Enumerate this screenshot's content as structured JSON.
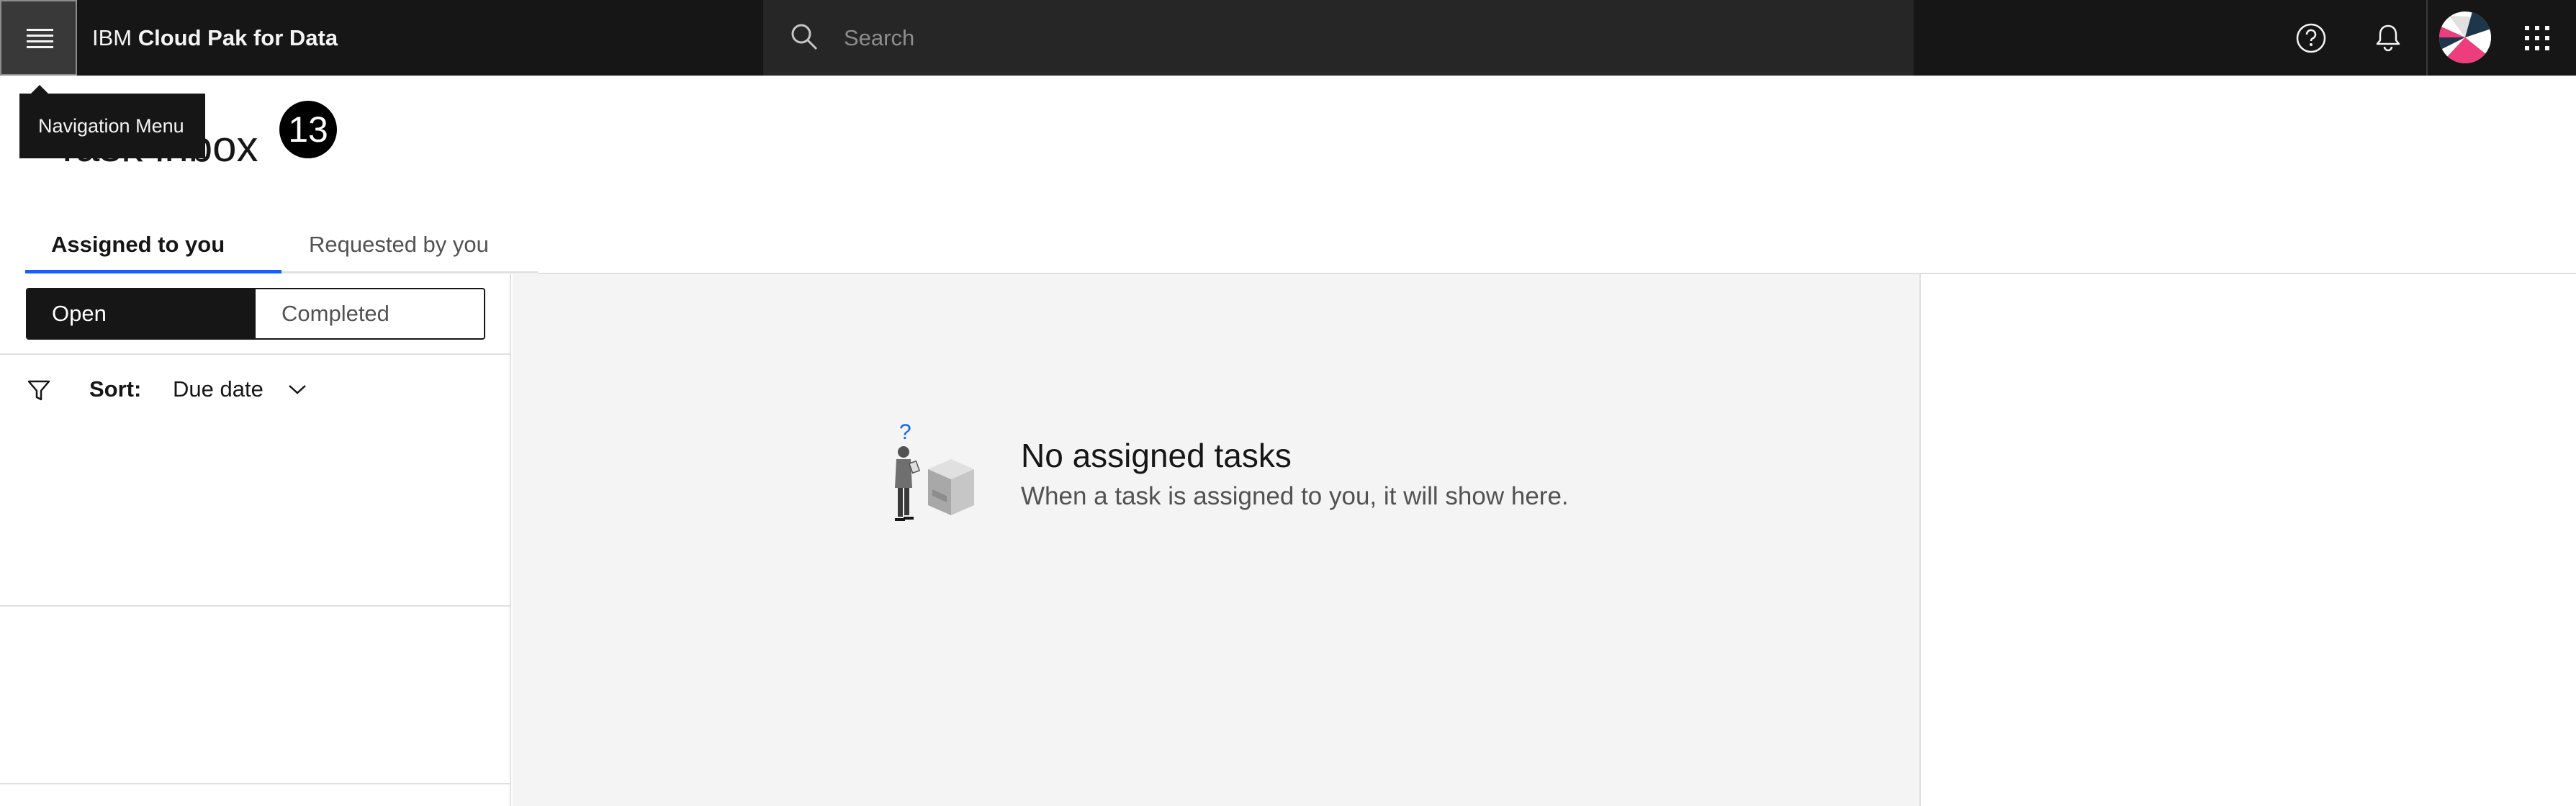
{
  "header": {
    "brand_prefix": "IBM",
    "brand_name": "Cloud Pak for Data",
    "search_placeholder": "Search",
    "icons": [
      "menu-icon",
      "search-icon",
      "help-icon",
      "notification-icon",
      "avatar",
      "app-switcher-icon"
    ]
  },
  "tooltip": {
    "text": "Navigation Menu"
  },
  "page": {
    "title": "Task inbox",
    "badge": "13"
  },
  "tabs": [
    {
      "label": "Assigned to you",
      "selected": true
    },
    {
      "label": "Requested by you",
      "selected": false
    }
  ],
  "filter": {
    "options": [
      {
        "label": "Open",
        "selected": true
      },
      {
        "label": "Completed",
        "selected": false
      }
    ]
  },
  "sort": {
    "label": "Sort:",
    "value": "Due date"
  },
  "empty_state": {
    "title": "No assigned tasks",
    "description": "When a task is assigned to you, it will show here."
  },
  "colors": {
    "header_bg": "#161616",
    "search_bg": "#262626",
    "tab_accent": "#0f62fe",
    "main_bg": "#f4f4f4"
  }
}
